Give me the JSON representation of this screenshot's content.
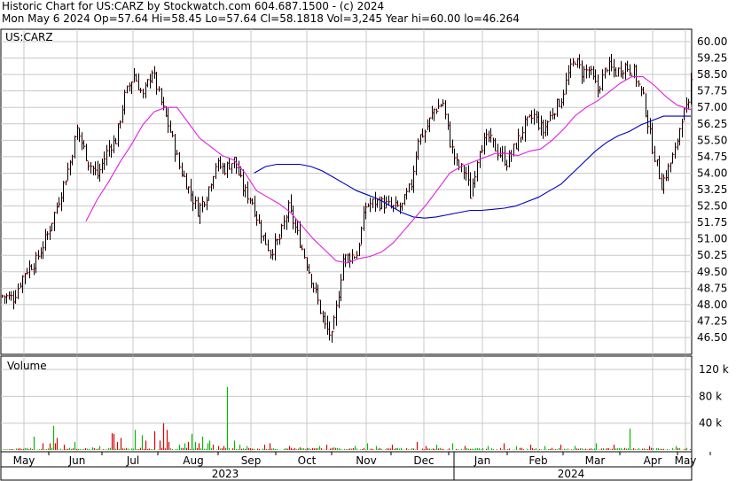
{
  "header": {
    "line1": "Historic Chart for US:CARZ by Stockwatch.com 604.687.1500 - (c) 2024",
    "line2": "Mon May  6 2024  Op=57.64  Hi=58.45  Lo=57.64  Cl=58.1818  Vol=3,245  Year hi=60.00  lo=46.264"
  },
  "colors": {
    "up_tick": "#000000",
    "close_tick": "#cc0000",
    "ma_short": "#e020e0",
    "ma_long": "#0000c0",
    "volume_up": "#00bb00",
    "volume_down": "#dd0000",
    "grid": "#c8c8c8"
  },
  "chart_data": {
    "type": "ohlc",
    "title": "US:CARZ",
    "price_axis": {
      "ticks": [
        "60.00",
        "59.25",
        "58.50",
        "57.75",
        "57.00",
        "56.25",
        "55.50",
        "54.75",
        "54.00",
        "53.25",
        "52.50",
        "51.75",
        "51.00",
        "50.25",
        "49.50",
        "48.75",
        "48.00",
        "47.25",
        "46.50"
      ],
      "range": [
        45.9,
        60.4
      ]
    },
    "x_axis": {
      "months": [
        "May",
        "Jun",
        "Jul",
        "Aug",
        "Sep",
        "Oct",
        "Nov",
        "Dec",
        "Jan",
        "Feb",
        "Mar",
        "Apr",
        "May"
      ],
      "years": [
        "2023",
        "2024"
      ]
    },
    "price_anchors": [
      {
        "i": 0,
        "c": 48.4
      },
      {
        "i": 5,
        "c": 48.3
      },
      {
        "i": 10,
        "c": 49.5
      },
      {
        "i": 15,
        "c": 50.0
      },
      {
        "i": 20,
        "c": 51.2
      },
      {
        "i": 25,
        "c": 52.8
      },
      {
        "i": 30,
        "c": 54.5
      },
      {
        "i": 33,
        "c": 56.0
      },
      {
        "i": 38,
        "c": 54.5
      },
      {
        "i": 42,
        "c": 53.9
      },
      {
        "i": 47,
        "c": 55.2
      },
      {
        "i": 50,
        "c": 55.5
      },
      {
        "i": 54,
        "c": 57.5
      },
      {
        "i": 58,
        "c": 58.5
      },
      {
        "i": 62,
        "c": 57.5
      },
      {
        "i": 66,
        "c": 58.7
      },
      {
        "i": 70,
        "c": 57.2
      },
      {
        "i": 74,
        "c": 55.9
      },
      {
        "i": 78,
        "c": 54.3
      },
      {
        "i": 82,
        "c": 53.3
      },
      {
        "i": 86,
        "c": 52.3
      },
      {
        "i": 90,
        "c": 53.0
      },
      {
        "i": 94,
        "c": 54.4
      },
      {
        "i": 98,
        "c": 54.2
      },
      {
        "i": 102,
        "c": 54.6
      },
      {
        "i": 106,
        "c": 53.3
      },
      {
        "i": 110,
        "c": 52.7
      },
      {
        "i": 114,
        "c": 51.3
      },
      {
        "i": 118,
        "c": 50.4
      },
      {
        "i": 122,
        "c": 51.0
      },
      {
        "i": 126,
        "c": 52.4
      },
      {
        "i": 130,
        "c": 51.2
      },
      {
        "i": 134,
        "c": 49.9
      },
      {
        "i": 138,
        "c": 48.5
      },
      {
        "i": 142,
        "c": 47.0
      },
      {
        "i": 145,
        "c": 46.5
      },
      {
        "i": 147,
        "c": 47.8
      },
      {
        "i": 150,
        "c": 50.1
      },
      {
        "i": 153,
        "c": 50.2
      },
      {
        "i": 156,
        "c": 50.3
      },
      {
        "i": 160,
        "c": 52.5
      },
      {
        "i": 164,
        "c": 52.7
      },
      {
        "i": 168,
        "c": 52.6
      },
      {
        "i": 172,
        "c": 52.4
      },
      {
        "i": 176,
        "c": 52.5
      },
      {
        "i": 180,
        "c": 53.5
      },
      {
        "i": 183,
        "c": 55.6
      },
      {
        "i": 186,
        "c": 55.9
      },
      {
        "i": 190,
        "c": 56.9
      },
      {
        "i": 194,
        "c": 57.2
      },
      {
        "i": 197,
        "c": 55.4
      },
      {
        "i": 200,
        "c": 54.4
      },
      {
        "i": 204,
        "c": 54.0
      },
      {
        "i": 206,
        "c": 53.0
      },
      {
        "i": 210,
        "c": 55.2
      },
      {
        "i": 214,
        "c": 55.6
      },
      {
        "i": 218,
        "c": 55.0
      },
      {
        "i": 222,
        "c": 54.5
      },
      {
        "i": 226,
        "c": 55.3
      },
      {
        "i": 230,
        "c": 56.2
      },
      {
        "i": 234,
        "c": 56.6
      },
      {
        "i": 238,
        "c": 55.9
      },
      {
        "i": 242,
        "c": 56.8
      },
      {
        "i": 246,
        "c": 57.4
      },
      {
        "i": 249,
        "c": 58.5
      },
      {
        "i": 252,
        "c": 59.2
      },
      {
        "i": 255,
        "c": 58.6
      },
      {
        "i": 258,
        "c": 58.7
      },
      {
        "i": 262,
        "c": 57.8
      },
      {
        "i": 266,
        "c": 58.9
      },
      {
        "i": 270,
        "c": 58.6
      },
      {
        "i": 274,
        "c": 58.9
      },
      {
        "i": 278,
        "c": 58.6
      },
      {
        "i": 282,
        "c": 57.4
      },
      {
        "i": 286,
        "c": 55.2
      },
      {
        "i": 290,
        "c": 53.5
      },
      {
        "i": 293,
        "c": 54.2
      },
      {
        "i": 296,
        "c": 55.0
      },
      {
        "i": 299,
        "c": 56.6
      },
      {
        "i": 302,
        "c": 57.0
      },
      {
        "i": 303,
        "c": 58.18
      }
    ],
    "moving_averages": [
      {
        "name": "short MA",
        "points": [
          {
            "i": 37,
            "c": 51.8
          },
          {
            "i": 42,
            "c": 52.8
          },
          {
            "i": 47,
            "c": 53.6
          },
          {
            "i": 52,
            "c": 54.5
          },
          {
            "i": 57,
            "c": 55.3
          },
          {
            "i": 62,
            "c": 56.2
          },
          {
            "i": 67,
            "c": 56.8
          },
          {
            "i": 72,
            "c": 57.0
          },
          {
            "i": 77,
            "c": 57.0
          },
          {
            "i": 82,
            "c": 56.3
          },
          {
            "i": 87,
            "c": 55.6
          },
          {
            "i": 92,
            "c": 55.2
          },
          {
            "i": 97,
            "c": 54.8
          },
          {
            "i": 102,
            "c": 54.6
          },
          {
            "i": 107,
            "c": 54.0
          },
          {
            "i": 112,
            "c": 53.2
          },
          {
            "i": 117,
            "c": 52.9
          },
          {
            "i": 122,
            "c": 52.6
          },
          {
            "i": 127,
            "c": 52.2
          },
          {
            "i": 132,
            "c": 51.6
          },
          {
            "i": 137,
            "c": 51.0
          },
          {
            "i": 142,
            "c": 50.5
          },
          {
            "i": 147,
            "c": 50.0
          },
          {
            "i": 152,
            "c": 49.9
          },
          {
            "i": 157,
            "c": 50.1
          },
          {
            "i": 162,
            "c": 50.2
          },
          {
            "i": 167,
            "c": 50.4
          },
          {
            "i": 172,
            "c": 50.8
          },
          {
            "i": 177,
            "c": 51.4
          },
          {
            "i": 182,
            "c": 52.0
          },
          {
            "i": 187,
            "c": 52.6
          },
          {
            "i": 192,
            "c": 53.3
          },
          {
            "i": 197,
            "c": 54.0
          },
          {
            "i": 202,
            "c": 54.3
          },
          {
            "i": 207,
            "c": 54.5
          },
          {
            "i": 212,
            "c": 54.7
          },
          {
            "i": 217,
            "c": 54.9
          },
          {
            "i": 222,
            "c": 54.9
          },
          {
            "i": 227,
            "c": 54.8
          },
          {
            "i": 232,
            "c": 55.0
          },
          {
            "i": 237,
            "c": 55.1
          },
          {
            "i": 242,
            "c": 55.5
          },
          {
            "i": 247,
            "c": 56.0
          },
          {
            "i": 252,
            "c": 56.6
          },
          {
            "i": 257,
            "c": 57.0
          },
          {
            "i": 262,
            "c": 57.3
          },
          {
            "i": 267,
            "c": 57.7
          },
          {
            "i": 272,
            "c": 58.1
          },
          {
            "i": 277,
            "c": 58.4
          },
          {
            "i": 282,
            "c": 58.4
          },
          {
            "i": 287,
            "c": 58.0
          },
          {
            "i": 292,
            "c": 57.5
          },
          {
            "i": 297,
            "c": 57.1
          },
          {
            "i": 303,
            "c": 56.9
          }
        ]
      },
      {
        "name": "long MA",
        "points": [
          {
            "i": 111,
            "c": 54.0
          },
          {
            "i": 116,
            "c": 54.3
          },
          {
            "i": 121,
            "c": 54.4
          },
          {
            "i": 126,
            "c": 54.4
          },
          {
            "i": 131,
            "c": 54.4
          },
          {
            "i": 136,
            "c": 54.3
          },
          {
            "i": 141,
            "c": 54.1
          },
          {
            "i": 146,
            "c": 53.8
          },
          {
            "i": 151,
            "c": 53.5
          },
          {
            "i": 156,
            "c": 53.2
          },
          {
            "i": 161,
            "c": 53.0
          },
          {
            "i": 166,
            "c": 52.8
          },
          {
            "i": 171,
            "c": 52.5
          },
          {
            "i": 176,
            "c": 52.2
          },
          {
            "i": 181,
            "c": 52.0
          },
          {
            "i": 186,
            "c": 51.95
          },
          {
            "i": 191,
            "c": 52.0
          },
          {
            "i": 196,
            "c": 52.1
          },
          {
            "i": 201,
            "c": 52.2
          },
          {
            "i": 206,
            "c": 52.3
          },
          {
            "i": 211,
            "c": 52.3
          },
          {
            "i": 216,
            "c": 52.35
          },
          {
            "i": 221,
            "c": 52.4
          },
          {
            "i": 226,
            "c": 52.5
          },
          {
            "i": 231,
            "c": 52.7
          },
          {
            "i": 236,
            "c": 52.9
          },
          {
            "i": 241,
            "c": 53.2
          },
          {
            "i": 246,
            "c": 53.5
          },
          {
            "i": 251,
            "c": 54.0
          },
          {
            "i": 256,
            "c": 54.5
          },
          {
            "i": 261,
            "c": 55.0
          },
          {
            "i": 266,
            "c": 55.4
          },
          {
            "i": 271,
            "c": 55.7
          },
          {
            "i": 276,
            "c": 55.9
          },
          {
            "i": 281,
            "c": 56.2
          },
          {
            "i": 286,
            "c": 56.4
          },
          {
            "i": 291,
            "c": 56.6
          },
          {
            "i": 296,
            "c": 56.6
          },
          {
            "i": 300,
            "c": 56.6
          },
          {
            "i": 303,
            "c": 56.6
          }
        ]
      }
    ],
    "volume": {
      "label": "Volume",
      "ticks": [
        "120 k",
        "80 k",
        "40 k"
      ],
      "range": [
        0,
        140
      ],
      "spikes_k": [
        {
          "i": 28,
          "v": 3
        },
        {
          "i": 36,
          "v": 20
        },
        {
          "i": 46,
          "v": 10
        },
        {
          "i": 51,
          "v": 8
        },
        {
          "i": 54,
          "v": 10
        },
        {
          "i": 58,
          "v": 36
        },
        {
          "i": 60,
          "v": 10
        },
        {
          "i": 62,
          "v": 18
        },
        {
          "i": 65,
          "v": 8
        },
        {
          "i": 70,
          "v": 8
        },
        {
          "i": 82,
          "v": 12
        },
        {
          "i": 93,
          "v": 122
        },
        {
          "i": 102,
          "v": 4
        },
        {
          "i": 110,
          "v": 6
        },
        {
          "i": 124,
          "v": 25
        },
        {
          "i": 126,
          "v": 24
        },
        {
          "i": 130,
          "v": 12
        },
        {
          "i": 134,
          "v": 18
        },
        {
          "i": 150,
          "v": 30
        },
        {
          "i": 158,
          "v": 22
        },
        {
          "i": 162,
          "v": 14
        },
        {
          "i": 165,
          "v": 42
        },
        {
          "i": 172,
          "v": 28
        },
        {
          "i": 175,
          "v": 20
        },
        {
          "i": 178,
          "v": 14
        },
        {
          "i": 182,
          "v": 40
        },
        {
          "i": 186,
          "v": 30
        },
        {
          "i": 188,
          "v": 12
        },
        {
          "i": 193,
          "v": 18
        },
        {
          "i": 197,
          "v": 20
        },
        {
          "i": 200,
          "v": 8
        },
        {
          "i": 203,
          "v": 20
        },
        {
          "i": 206,
          "v": 10
        },
        {
          "i": 210,
          "v": 12
        },
        {
          "i": 214,
          "v": 24
        },
        {
          "i": 218,
          "v": 12
        },
        {
          "i": 222,
          "v": 10
        },
        {
          "i": 226,
          "v": 20
        },
        {
          "i": 232,
          "v": 10
        },
        {
          "i": 234,
          "v": 14
        },
        {
          "i": 238,
          "v": 8
        },
        {
          "i": 244,
          "v": 6
        },
        {
          "i": 250,
          "v": 6
        },
        {
          "i": 254,
          "v": 94
        },
        {
          "i": 262,
          "v": 14
        },
        {
          "i": 268,
          "v": 8
        },
        {
          "i": 276,
          "v": 6
        },
        {
          "i": 296,
          "v": 8
        },
        {
          "i": 302,
          "v": 10
        },
        {
          "i": 324,
          "v": 6
        },
        {
          "i": 336,
          "v": 4
        },
        {
          "i": 358,
          "v": 6
        },
        {
          "i": 366,
          "v": 8
        },
        {
          "i": 374,
          "v": 4
        },
        {
          "i": 398,
          "v": 6
        },
        {
          "i": 412,
          "v": 10
        },
        {
          "i": 422,
          "v": 6
        },
        {
          "i": 440,
          "v": 8
        },
        {
          "i": 468,
          "v": 12
        },
        {
          "i": 478,
          "v": 6
        },
        {
          "i": 490,
          "v": 8
        },
        {
          "i": 508,
          "v": 10
        },
        {
          "i": 522,
          "v": 6
        },
        {
          "i": 548,
          "v": 6
        },
        {
          "i": 566,
          "v": 10
        },
        {
          "i": 580,
          "v": 6
        },
        {
          "i": 596,
          "v": 8
        },
        {
          "i": 612,
          "v": 6
        },
        {
          "i": 630,
          "v": 8
        },
        {
          "i": 646,
          "v": 6
        },
        {
          "i": 670,
          "v": 10
        },
        {
          "i": 690,
          "v": 8
        },
        {
          "i": 708,
          "v": 32
        },
        {
          "i": 730,
          "v": 6
        },
        {
          "i": 760,
          "v": 6
        }
      ]
    }
  }
}
